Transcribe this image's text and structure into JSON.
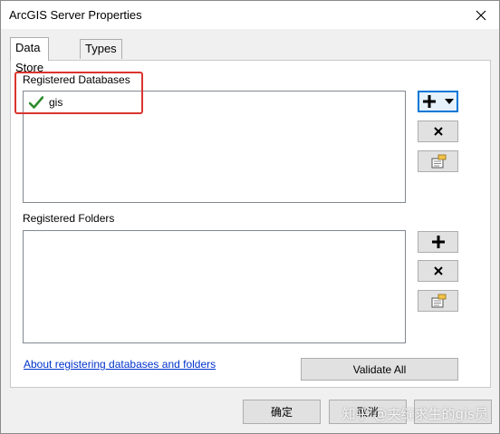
{
  "window": {
    "title": "ArcGIS Server Properties"
  },
  "tabs": [
    {
      "label": "Data Store",
      "active": true
    },
    {
      "label": "Types",
      "active": false
    }
  ],
  "databases": {
    "label": "Registered Databases",
    "items": [
      {
        "name": "gis",
        "status_icon": "checkmark-icon"
      }
    ]
  },
  "folders": {
    "label": "Registered Folders",
    "items": []
  },
  "link_text": "About registering databases and folders",
  "validate_label": "Validate All",
  "footer": {
    "ok_label": "确定",
    "cancel_label": "取消"
  },
  "watermark_text": "知乎 @夹缝求生的gis员",
  "colors": {
    "highlight": "#d9352f",
    "check": "#2e8b2e",
    "link": "#0033cc",
    "selected_border": "#0078d7"
  }
}
